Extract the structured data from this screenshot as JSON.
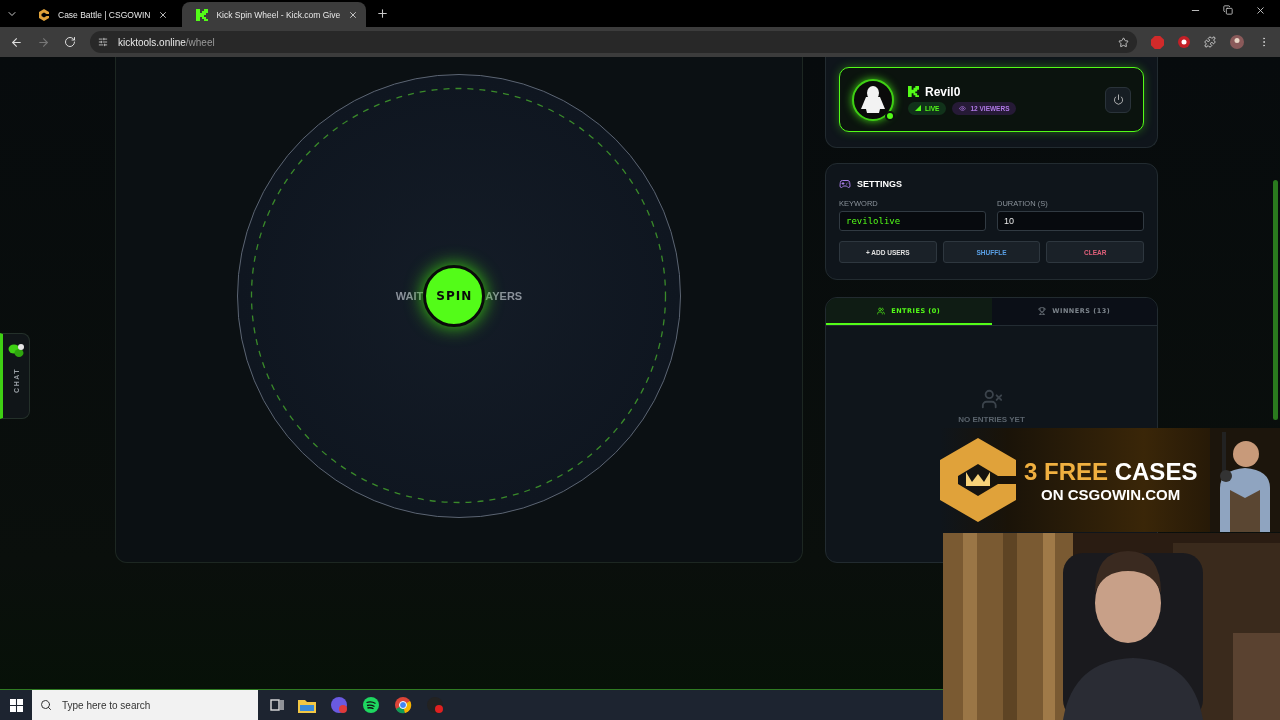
{
  "browser": {
    "tabs": [
      {
        "title": "Case Battle | CSGOWIN",
        "selected": false,
        "kind": "csgowin"
      },
      {
        "title": "Kick Spin Wheel - Kick.com Give",
        "selected": true,
        "kind": "kick"
      }
    ],
    "url": {
      "host": "kicktools.online",
      "path": "/wheel"
    }
  },
  "chat_tab": {
    "label": "CHAT",
    "unread": true
  },
  "wheel": {
    "status_left": "WAIT",
    "spin_label": "SPIN",
    "status_right": "AYERS"
  },
  "profile": {
    "username": "Revil0",
    "live": "LIVE",
    "viewers": "12 VIEWERS",
    "online": true
  },
  "settings": {
    "title": "SETTINGS",
    "keyword": {
      "label": "KEYWORD",
      "value": "revilolive"
    },
    "duration": {
      "label": "DURATION (S)",
      "value": "10"
    },
    "buttons": [
      {
        "kind": "add",
        "label": "+ ADD USERS"
      },
      {
        "kind": "shuffle",
        "label": "SHUFFLE"
      },
      {
        "kind": "clear",
        "label": "CLEAR"
      }
    ]
  },
  "list_tabs": [
    {
      "kind": "entries",
      "label": "ENTRIES (0)",
      "selected": true
    },
    {
      "kind": "winners",
      "label": "WINNERS (13)",
      "selected": false
    }
  ],
  "empty_message": "NO ENTRIES YET",
  "ad": {
    "highlight": "3 FREE",
    "headline": "CASES",
    "subline": "ON CSGOWIN.COM"
  },
  "taskbar": {
    "search_placeholder": "Type here to search"
  }
}
